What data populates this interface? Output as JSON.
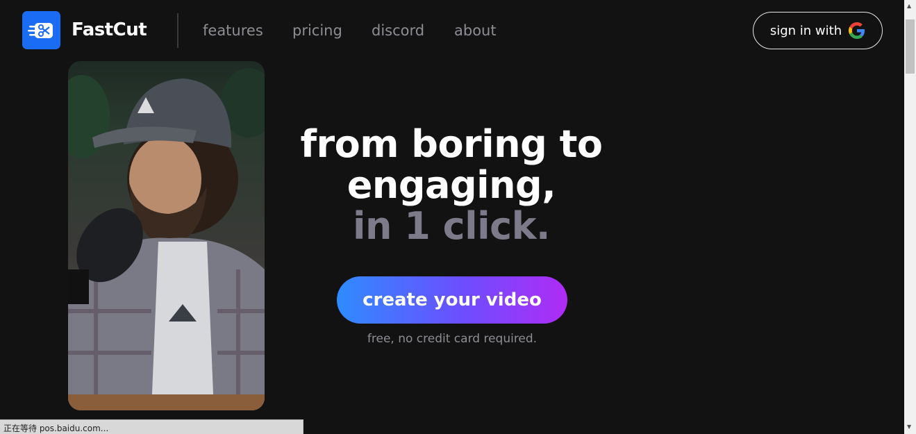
{
  "brand": {
    "name": "FastCut",
    "logo_icon": "scissors-fast-icon",
    "accent": "#1a6cf5"
  },
  "nav": {
    "items": [
      {
        "label": "features"
      },
      {
        "label": "pricing"
      },
      {
        "label": "discord"
      },
      {
        "label": "about"
      }
    ]
  },
  "signin": {
    "label": "sign in with",
    "icon": "google-icon"
  },
  "video": {
    "alt": "podcast host with cap speaking into microphone"
  },
  "hero": {
    "line1": "from boring to",
    "line2": "engaging,",
    "line3": "in 1 click."
  },
  "cta": {
    "label": "create your video",
    "note": "free, no credit card required.",
    "gradient": [
      "#2f8bff",
      "#b02cf5"
    ]
  },
  "statusbar": {
    "text": "正在等待 pos.baidu.com..."
  }
}
